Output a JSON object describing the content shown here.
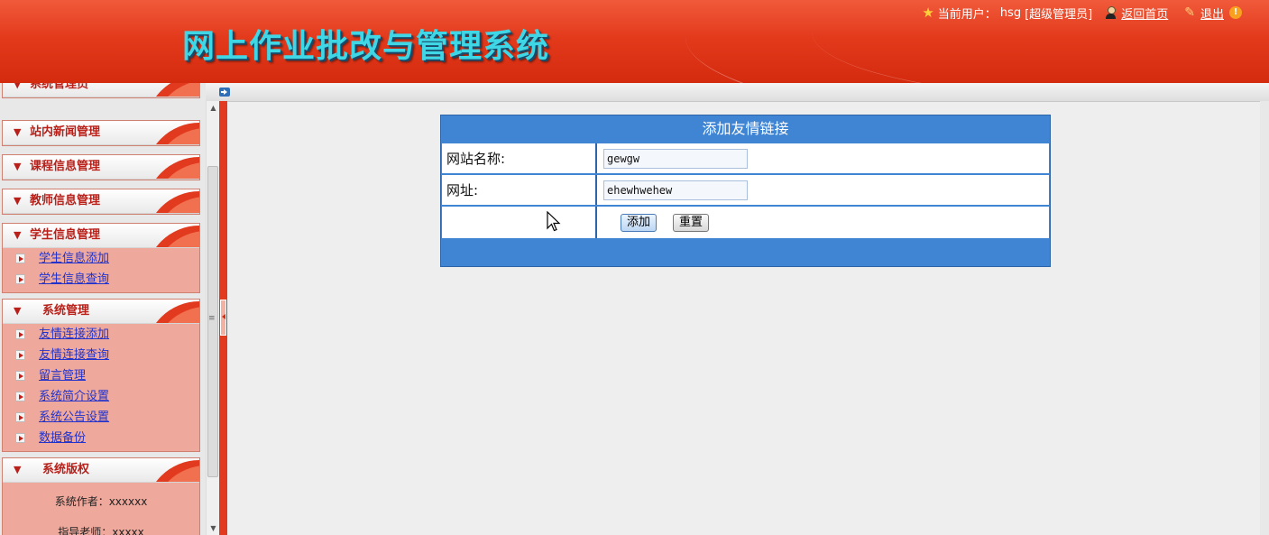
{
  "header": {
    "app_title": "网上作业批改与管理系统",
    "current_user_label": "当前用户：",
    "current_user": "hsg",
    "role": "[超级管理员]",
    "home_link": "返回首页",
    "logout_link": "退出"
  },
  "sidebar": {
    "sections": [
      {
        "title": "系统管理员",
        "items": []
      },
      {
        "title": "站内新闻管理",
        "items": []
      },
      {
        "title": "课程信息管理",
        "items": []
      },
      {
        "title": "教师信息管理",
        "items": []
      },
      {
        "title": "学生信息管理",
        "items": [
          "学生信息添加",
          "学生信息查询"
        ]
      },
      {
        "title": "系统管理",
        "items": [
          "友情连接添加",
          "友情连接查询",
          "留言管理",
          "系统简介设置",
          "系统公告设置",
          "数据备份"
        ]
      },
      {
        "title": "系统版权",
        "info": [
          "系统作者：xxxxxx",
          "指导老师：xxxxx"
        ]
      }
    ]
  },
  "form": {
    "title": "添加友情链接",
    "site_name_label": "网站名称:",
    "site_name_value": "gewgw",
    "url_label": "网址:",
    "url_value": "ehewhwehew",
    "add_button": "添加",
    "reset_button": "重置"
  },
  "colors": {
    "header_red": "#e33a1c",
    "form_blue": "#3f85d4",
    "title_cyan": "#3fd6e6",
    "menu_pink": "#eea89c"
  }
}
